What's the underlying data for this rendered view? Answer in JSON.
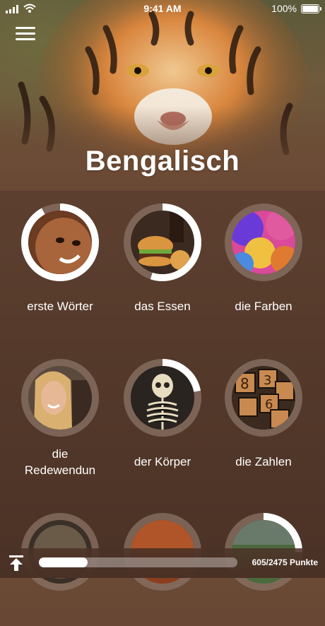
{
  "status_bar": {
    "time": "9:41 AM",
    "battery": "100%"
  },
  "header": {
    "title": "Bengalisch"
  },
  "categories": [
    {
      "label": "erste Wörter",
      "progress": 0.92,
      "icon": "baby-face"
    },
    {
      "label": "das Essen",
      "progress": 0.55,
      "icon": "burger-meal"
    },
    {
      "label": "die Farben",
      "progress": 0,
      "icon": "color-powder"
    },
    {
      "label": "die\nRedewendun",
      "progress": 0,
      "icon": "smiling-woman"
    },
    {
      "label": "der Körper",
      "progress": 0.22,
      "icon": "skeleton"
    },
    {
      "label": "die Zahlen",
      "progress": 0,
      "icon": "number-blocks"
    },
    {
      "label": "",
      "progress": 0,
      "icon": "world-globe"
    },
    {
      "label": "",
      "progress": 0,
      "icon": "sunset"
    },
    {
      "label": "",
      "progress": 0.25,
      "icon": "landscape"
    }
  ],
  "footer": {
    "points_text": "605/2475 Punkte",
    "progress": 0.2444
  },
  "colors": {
    "ring_track": "#8a7366",
    "ring_fill": "#ffffff",
    "accent": "#ffffff"
  }
}
